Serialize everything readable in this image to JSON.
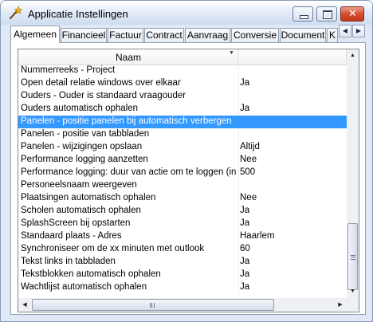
{
  "window": {
    "title": "Applicatie Instellingen",
    "icon": "settings-wand-icon",
    "buttons": {
      "minimize_icon": "minimize-icon",
      "maximize_icon": "maximize-icon",
      "close_icon": "close-icon",
      "close_glyph": "✕"
    }
  },
  "tabs": [
    {
      "label": "Algemeen",
      "active": true
    },
    {
      "label": "Financieel"
    },
    {
      "label": "Factuur"
    },
    {
      "label": "Contract"
    },
    {
      "label": "Aanvraag"
    },
    {
      "label": "Conversie"
    },
    {
      "label": "Document"
    },
    {
      "label": "K"
    }
  ],
  "tab_scroll": {
    "left": "◀",
    "right": "▶"
  },
  "grid": {
    "columns": {
      "name": "Naam",
      "value": ""
    },
    "sort_glyph": "▼",
    "rows": [
      {
        "name": "Nummerreeks - Project",
        "value": ""
      },
      {
        "name": "Open detail relatie windows over elkaar",
        "value": "Ja"
      },
      {
        "name": "Ouders - Ouder is standaard vraagouder",
        "value": ""
      },
      {
        "name": "Ouders automatisch ophalen",
        "value": "Ja"
      },
      {
        "name": "Panelen - positie panelen bij automatisch verbergen",
        "value": "",
        "selected": true
      },
      {
        "name": "Panelen - positie van tabbladen",
        "value": ""
      },
      {
        "name": "Panelen - wijzigingen opslaan",
        "value": "Altijd"
      },
      {
        "name": "Performance logging aanzetten",
        "value": "Nee"
      },
      {
        "name": "Performance logging: duur van actie om te loggen (in millisec)",
        "value": "500"
      },
      {
        "name": "Personeelsnaam weergeven",
        "value": ""
      },
      {
        "name": "Plaatsingen automatisch ophalen",
        "value": "Nee"
      },
      {
        "name": "Scholen automatisch ophalen",
        "value": "Ja"
      },
      {
        "name": "SplashScreen bij opstarten",
        "value": "Ja"
      },
      {
        "name": "Standaard plaats - Adres",
        "value": "Haarlem"
      },
      {
        "name": "Synchroniseer om de xx minuten met outlook",
        "value": "60"
      },
      {
        "name": "Tekst links in tabbladen",
        "value": "Ja"
      },
      {
        "name": "Tekstblokken automatisch ophalen",
        "value": "Ja"
      },
      {
        "name": "Wachtlijst automatisch ophalen",
        "value": "Ja"
      }
    ]
  },
  "scrollbars": {
    "up": "▲",
    "down": "▼",
    "left": "◀",
    "right": "▶",
    "vertical_position": 0.72,
    "horizontal_position": 0.0
  },
  "colors": {
    "selection": "#3399ff",
    "close_button": "#d4502f"
  }
}
